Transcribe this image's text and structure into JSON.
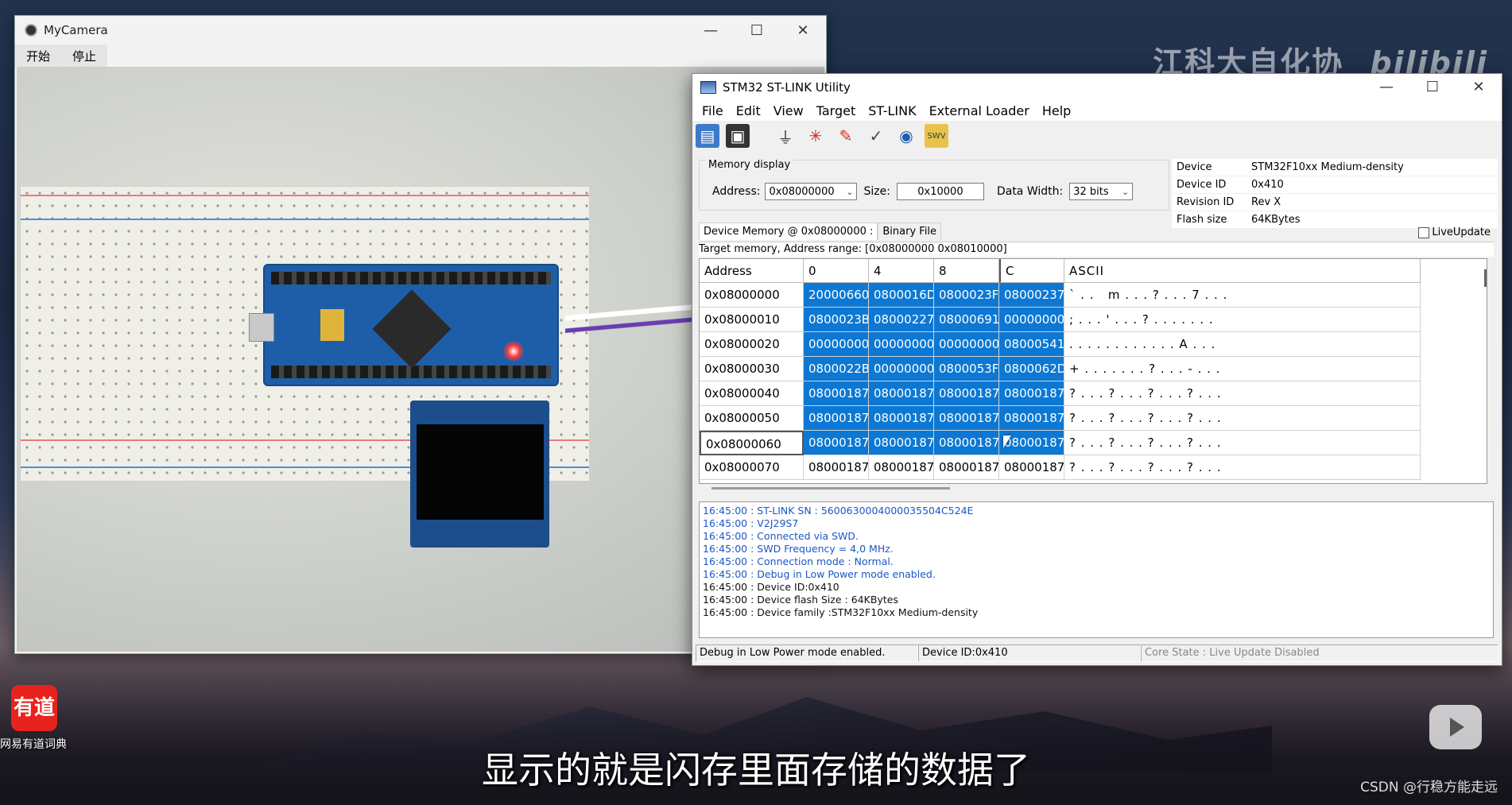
{
  "desktop": {
    "watermark": "江科大自化协",
    "bilibili_logo": "bilibili",
    "subtitle": "显示的就是闪存里面存储的数据了",
    "csdn_credit": "CSDN @行稳方能走远",
    "app_icon_glyph": "有道",
    "app_icon_label": "网易有道词典"
  },
  "camera_window": {
    "title": "MyCamera",
    "menu": [
      "开始",
      "停止"
    ],
    "controls": [
      "—",
      "☐",
      "✕"
    ]
  },
  "stlink": {
    "title": "STM32 ST-LINK Utility",
    "controls": [
      "—",
      "☐",
      "✕"
    ],
    "menu": [
      "File",
      "Edit",
      "View",
      "Target",
      "ST-LINK",
      "External Loader",
      "Help"
    ],
    "toolbar_icons": [
      "open-file-icon",
      "save-icon",
      "connect-icon",
      "disconnect-icon",
      "erase-icon",
      "verify-icon",
      "web-icon",
      "swv-icon"
    ],
    "memory_display": {
      "legend": "Memory display",
      "address_label": "Address:",
      "address_value": "0x08000000",
      "size_label": "Size:",
      "size_value": "0x10000",
      "width_label": "Data Width:",
      "width_value": "32 bits"
    },
    "device_info": [
      {
        "label": "Device",
        "value": "STM32F10xx Medium-density"
      },
      {
        "label": "Device ID",
        "value": "0x410"
      },
      {
        "label": "Revision ID",
        "value": "Rev X"
      },
      {
        "label": "Flash size",
        "value": "64KBytes"
      }
    ],
    "tabs": [
      "Device Memory @ 0x08000000 :",
      "Binary File"
    ],
    "live_update": "LiveUpdate",
    "range_text": "Target memory, Address range: [0x08000000 0x08010000]",
    "grid_headers": [
      "Address",
      "0",
      "4",
      "8",
      "C",
      "ASCII"
    ],
    "grid_rows": [
      {
        "addr": "0x08000000",
        "vals": [
          "20000660",
          "0800016D",
          "0800023F",
          "08000237"
        ],
        "ascii": "` . .   m . . . ? . . . 7 . . ."
      },
      {
        "addr": "0x08000010",
        "vals": [
          "0800023B",
          "08000227",
          "08000691",
          "00000000"
        ],
        "ascii": "; . . . ' . . . ? . . . . . . ."
      },
      {
        "addr": "0x08000020",
        "vals": [
          "00000000",
          "00000000",
          "00000000",
          "08000541"
        ],
        "ascii": ". . . . . . . . . . . . A . . ."
      },
      {
        "addr": "0x08000030",
        "vals": [
          "0800022B",
          "00000000",
          "0800053F",
          "0800062D"
        ],
        "ascii": "+ . . . . . . . ? . . . - . . ."
      },
      {
        "addr": "0x08000040",
        "vals": [
          "08000187",
          "08000187",
          "08000187",
          "08000187"
        ],
        "ascii": "? . . . ? . . . ? . . . ? . . ."
      },
      {
        "addr": "0x08000050",
        "vals": [
          "08000187",
          "08000187",
          "08000187",
          "08000187"
        ],
        "ascii": "? . . . ? . . . ? . . . ? . . ."
      },
      {
        "addr": "0x08000060",
        "vals": [
          "08000187",
          "08000187",
          "08000187",
          "08000187"
        ],
        "ascii": "? . . . ? . . . ? . . . ? . . ."
      },
      {
        "addr": "0x08000070",
        "vals": [
          "08000187",
          "08000187",
          "08000187",
          "08000187"
        ],
        "ascii": "? . . . ? . . . ? . . . ? . . ."
      }
    ],
    "highlight_rows": 7,
    "log": [
      {
        "text": "16:45:00 : ST-LINK SN : 5600630004000035504C524E",
        "color": "blue"
      },
      {
        "text": "16:45:00 : V2J29S7",
        "color": "blue"
      },
      {
        "text": "16:45:00 : Connected via SWD.",
        "color": "blue"
      },
      {
        "text": "16:45:00 : SWD Frequency = 4,0 MHz.",
        "color": "blue"
      },
      {
        "text": "16:45:00 : Connection mode : Normal.",
        "color": "blue"
      },
      {
        "text": "16:45:00 : Debug in Low Power mode enabled.",
        "color": "blue"
      },
      {
        "text": "16:45:00 : Device ID:0x410",
        "color": "black"
      },
      {
        "text": "16:45:00 : Device flash Size : 64KBytes",
        "color": "black"
      },
      {
        "text": "16:45:00 : Device family :STM32F10xx Medium-density",
        "color": "black"
      }
    ],
    "status": [
      "Debug in Low Power mode enabled.",
      "Device ID:0x410",
      "Core State : Live Update Disabled"
    ]
  }
}
